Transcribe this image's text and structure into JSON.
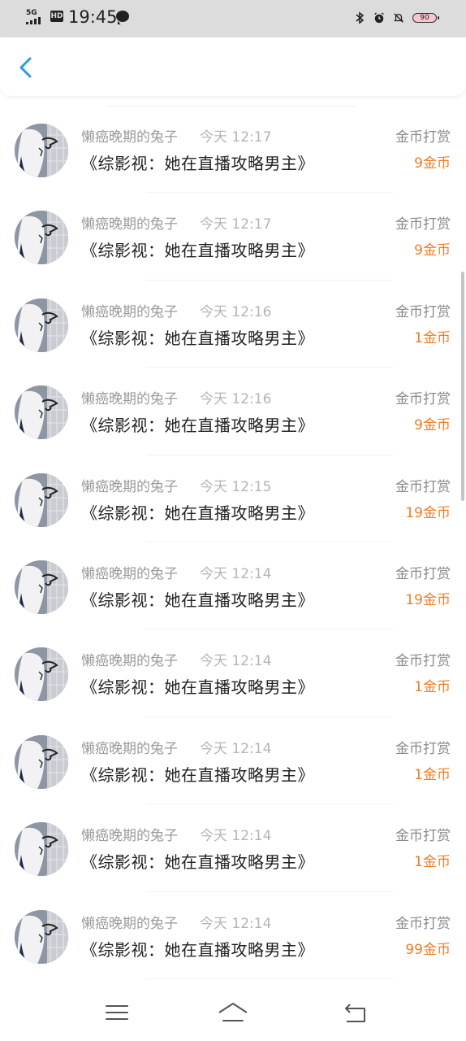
{
  "status_bar": {
    "network": "5G",
    "hd": "HD",
    "time": "19:45",
    "battery": "90",
    "icons": [
      "bluetooth-icon",
      "alarm-icon",
      "mute-icon"
    ]
  },
  "header": {
    "back_icon": "chevron-left-icon",
    "accent": "#2a9ae6"
  },
  "records": [
    {
      "name": "懒癌晚期的兔子",
      "time": "今天 12:17",
      "title": "《综影视：她在直播攻略男主》",
      "type": "金币打赏",
      "amount": "9金币"
    },
    {
      "name": "懒癌晚期的兔子",
      "time": "今天 12:17",
      "title": "《综影视：她在直播攻略男主》",
      "type": "金币打赏",
      "amount": "9金币"
    },
    {
      "name": "懒癌晚期的兔子",
      "time": "今天 12:16",
      "title": "《综影视：她在直播攻略男主》",
      "type": "金币打赏",
      "amount": "1金币"
    },
    {
      "name": "懒癌晚期的兔子",
      "time": "今天 12:16",
      "title": "《综影视：她在直播攻略男主》",
      "type": "金币打赏",
      "amount": "9金币"
    },
    {
      "name": "懒癌晚期的兔子",
      "time": "今天 12:15",
      "title": "《综影视：她在直播攻略男主》",
      "type": "金币打赏",
      "amount": "19金币"
    },
    {
      "name": "懒癌晚期的兔子",
      "time": "今天 12:14",
      "title": "《综影视：她在直播攻略男主》",
      "type": "金币打赏",
      "amount": "19金币"
    },
    {
      "name": "懒癌晚期的兔子",
      "time": "今天 12:14",
      "title": "《综影视：她在直播攻略男主》",
      "type": "金币打赏",
      "amount": "1金币"
    },
    {
      "name": "懒癌晚期的兔子",
      "time": "今天 12:14",
      "title": "《综影视：她在直播攻略男主》",
      "type": "金币打赏",
      "amount": "1金币"
    },
    {
      "name": "懒癌晚期的兔子",
      "time": "今天 12:14",
      "title": "《综影视：她在直播攻略男主》",
      "type": "金币打赏",
      "amount": "1金币"
    },
    {
      "name": "懒癌晚期的兔子",
      "time": "今天 12:14",
      "title": "《综影视：她在直播攻略男主》",
      "type": "金币打赏",
      "amount": "99金币"
    }
  ],
  "colors": {
    "amount": "#f07c24",
    "name": "#9a9a9a",
    "title": "#222222"
  },
  "nav_bar": {
    "icons": [
      "menu-icon",
      "home-icon",
      "back-icon"
    ]
  }
}
